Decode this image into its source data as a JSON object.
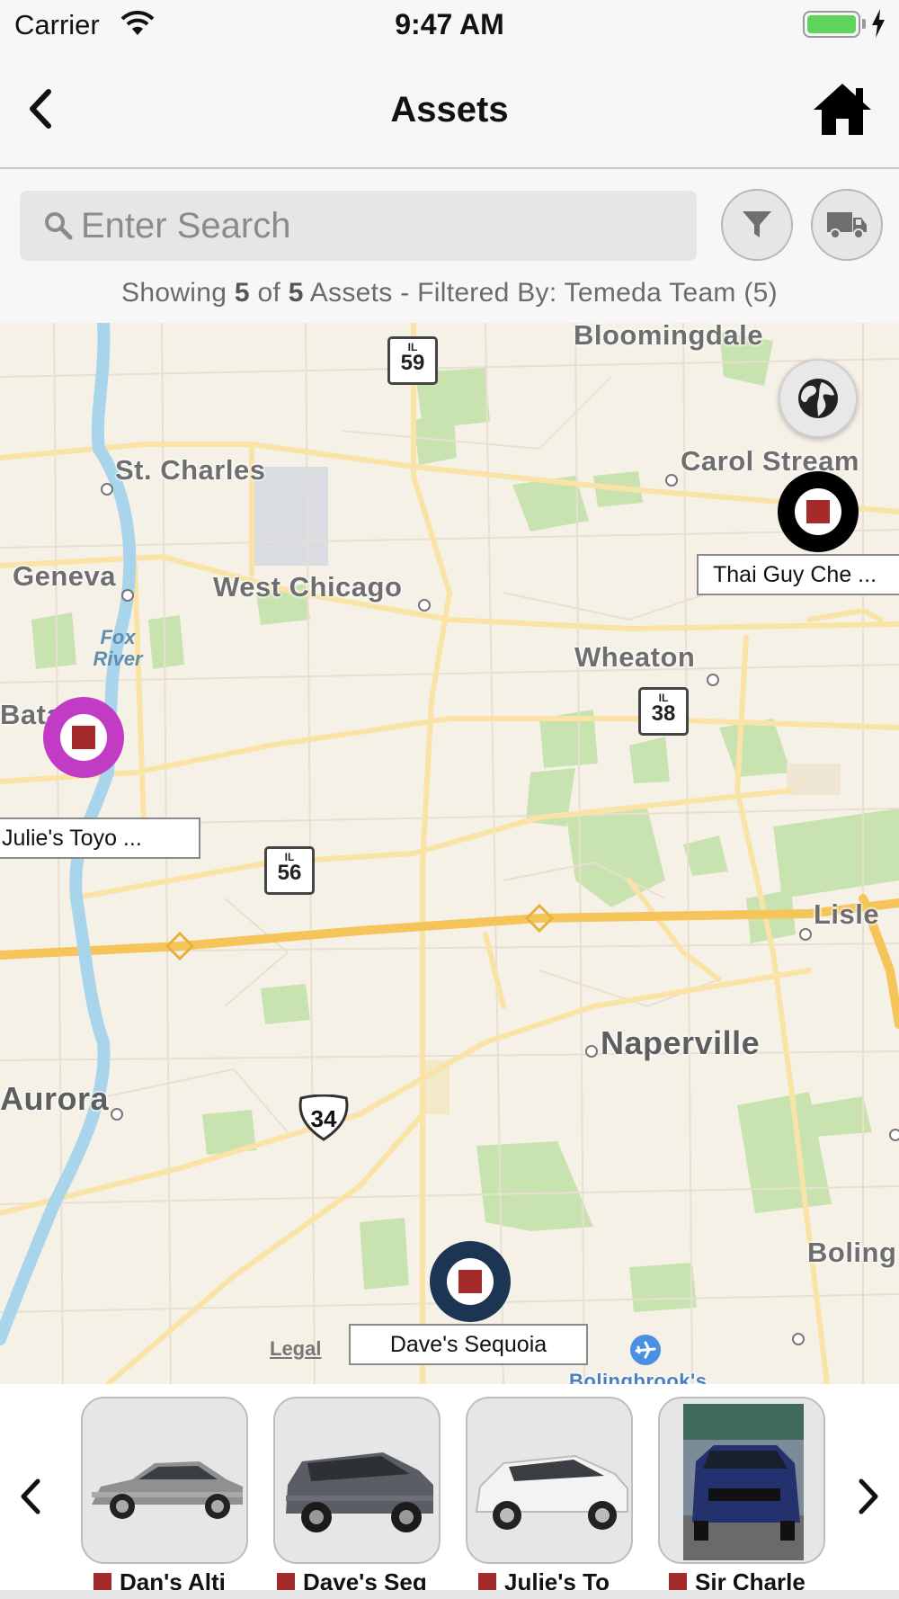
{
  "status_bar": {
    "carrier": "Carrier",
    "time": "9:47 AM",
    "battery_level": 1.0
  },
  "nav": {
    "title": "Assets",
    "back_icon": "chevron-left-icon",
    "home_icon": "home-icon"
  },
  "search": {
    "placeholder": "Enter Search",
    "value": "",
    "filter_icon": "funnel-icon",
    "truck_icon": "truck-icon"
  },
  "summary": {
    "prefix": "Showing ",
    "shown": "5",
    "of": " of ",
    "total": "5",
    "suffix": " Assets - Filtered By: Temeda Team (5)"
  },
  "map": {
    "places": [
      {
        "name": "Bloomingdale"
      },
      {
        "name": "St. Charles"
      },
      {
        "name": "Carol Stream"
      },
      {
        "name": "Geneva"
      },
      {
        "name": "West Chicago"
      },
      {
        "name": "Wheaton"
      },
      {
        "name": "Batavia"
      },
      {
        "name": "Lisle"
      },
      {
        "name": "Naperville"
      },
      {
        "name": "Aurora"
      },
      {
        "name": "Boling"
      }
    ],
    "water_label": "Fox\nRiver",
    "shields": [
      {
        "state": "IL",
        "number": "59"
      },
      {
        "state": "IL",
        "number": "38"
      },
      {
        "state": "IL",
        "number": "56"
      }
    ],
    "us_route": "34",
    "legal": "Legal",
    "globe_icon": "globe-icon",
    "airport_icon": "airplane-icon",
    "airport_label": "Bolingbrook's",
    "markers": [
      {
        "label": "Thai Guy Che ...",
        "ring_color": "#000000"
      },
      {
        "label": "Julie's Toyo ...",
        "ring_color": "#c13bc4"
      },
      {
        "label": "Dave's Sequoia",
        "ring_color": "#1c3553"
      }
    ],
    "colors": {
      "land": "#f6f1e7",
      "park": "#c9e3b0",
      "water": "#a8d4ec",
      "highway": "#f5c55a",
      "road": "#fae3a6",
      "status_red": "#a52a2a"
    }
  },
  "carousel": {
    "prev_icon": "chevron-left-icon",
    "next_icon": "chevron-right-icon",
    "items": [
      {
        "label": "Dan's Alti",
        "status_color": "#a52a2a",
        "image": "silver-sedan-photo"
      },
      {
        "label": "Dave's Seq",
        "status_color": "#a52a2a",
        "image": "gray-suv-photo"
      },
      {
        "label": "Julie's To",
        "status_color": "#a52a2a",
        "image": "white-suv-photo"
      },
      {
        "label": "Sir Charle",
        "status_color": "#a52a2a",
        "image": "blue-crossover-photo"
      }
    ]
  }
}
